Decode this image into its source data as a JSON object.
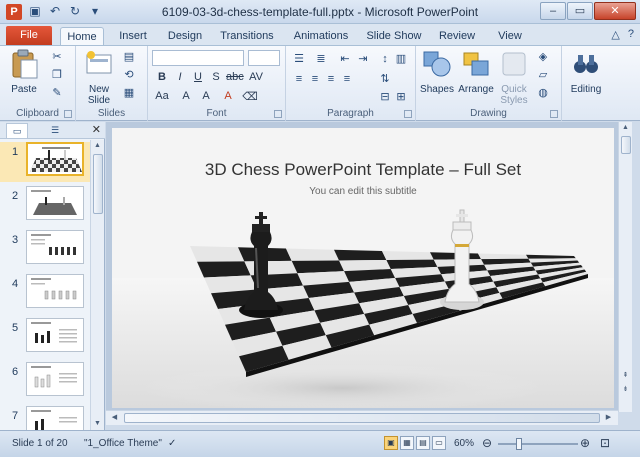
{
  "window": {
    "title": "6109-03-3d-chess-template-full.pptx - Microsoft PowerPoint",
    "app_badge": "P",
    "qat": [
      "save-icon",
      "undo-icon",
      "redo-icon",
      "customize-icon"
    ]
  },
  "tabs": [
    {
      "label": "File"
    },
    {
      "label": "Home"
    },
    {
      "label": "Insert"
    },
    {
      "label": "Design"
    },
    {
      "label": "Transitions"
    },
    {
      "label": "Animations"
    },
    {
      "label": "Slide Show"
    },
    {
      "label": "Review"
    },
    {
      "label": "View"
    }
  ],
  "ribbon": {
    "clipboard": {
      "label": "Clipboard",
      "paste": "Paste"
    },
    "slides": {
      "label": "Slides",
      "new_slide_1": "New",
      "new_slide_2": "Slide"
    },
    "font": {
      "label": "Font"
    },
    "paragraph": {
      "label": "Paragraph"
    },
    "drawing": {
      "label": "Drawing",
      "shapes": "Shapes",
      "arrange": "Arrange",
      "quick_styles_1": "Quick",
      "quick_styles_2": "Styles"
    },
    "editing": {
      "label": "Editing"
    }
  },
  "thumbnails": [
    {
      "num": "1"
    },
    {
      "num": "2"
    },
    {
      "num": "3"
    },
    {
      "num": "4"
    },
    {
      "num": "5"
    },
    {
      "num": "6"
    },
    {
      "num": "7"
    }
  ],
  "slide": {
    "title": "3D Chess PowerPoint Template – Full Set",
    "subtitle": "You can edit this subtitle"
  },
  "status": {
    "slide_info": "Slide 1 of 20",
    "theme": "\"1_Office Theme\"",
    "zoom": "60%"
  },
  "colors": {
    "accent": "#d24726",
    "board_dark": "#1e1e1e",
    "board_light": "#e6e6e6"
  }
}
